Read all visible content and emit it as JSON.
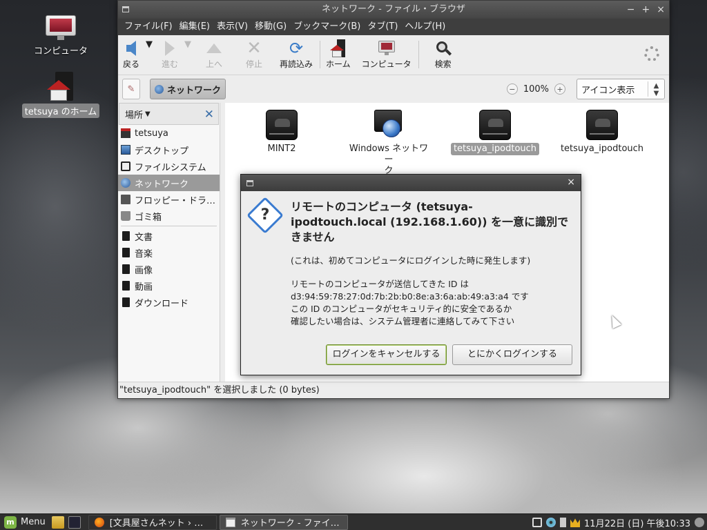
{
  "desktop": {
    "icons": [
      {
        "label": "コンピュータ"
      },
      {
        "label": "tetsuya のホーム"
      }
    ]
  },
  "window": {
    "title": "ネットワーク - ファイル・ブラウザ",
    "controls": {
      "minimize": "−",
      "maximize": "+",
      "close": "×"
    },
    "menu": [
      "ファイル(F)",
      "編集(E)",
      "表示(V)",
      "移動(G)",
      "ブックマーク(B)",
      "タブ(T)",
      "ヘルプ(H)"
    ],
    "toolbar": {
      "back": "戻る",
      "forward": "進む",
      "up": "上へ",
      "stop": "停止",
      "reload": "再読込み",
      "home": "ホーム",
      "computer": "コンピュータ",
      "search": "検索"
    },
    "location": {
      "path_button": "ネットワーク",
      "zoom_out": "−",
      "zoom": "100%",
      "zoom_in": "+",
      "view_mode": "アイコン表示"
    },
    "sidebar": {
      "header": "場所",
      "close": "✕",
      "places": [
        {
          "label": "tetsuya",
          "icon": "home-folder-icon"
        },
        {
          "label": "デスクトップ",
          "icon": "desktop-icon"
        },
        {
          "label": "ファイルシステム",
          "icon": "harddisk-icon"
        },
        {
          "label": "ネットワーク",
          "icon": "network-icon",
          "active": true
        },
        {
          "label": "フロッピー・ドラ…",
          "icon": "floppy-icon"
        },
        {
          "label": "ゴミ箱",
          "icon": "trash-icon"
        }
      ],
      "bookmarks": [
        {
          "label": "文書"
        },
        {
          "label": "音楽"
        },
        {
          "label": "画像"
        },
        {
          "label": "動画"
        },
        {
          "label": "ダウンロード"
        }
      ]
    },
    "files": [
      {
        "label": "MINT2",
        "icon": "network-drive-icon"
      },
      {
        "label_line1": "Windows ネットワー",
        "label_line2": "ク",
        "icon": "windows-network-icon"
      },
      {
        "label": "tetsuya_ipodtouch",
        "icon": "network-drive-icon",
        "selected": true
      },
      {
        "label": "tetsuya_ipodtouch",
        "icon": "network-drive-icon"
      }
    ],
    "status": "\"tetsuya_ipodtouch\" を選択しました (0 bytes)"
  },
  "dialog": {
    "close": "×",
    "heading_line1": "リモートのコンピュータ (tetsuya-",
    "heading_line2": "ipodtouch.local (192.168.1.60)) を一意に識別で",
    "heading_line3": "きません",
    "subtext": "(これは、初めてコンピュータにログインした時に発生します)",
    "body_line1": "リモートのコンピュータが送信してきた ID は",
    "body_line2": "d3:94:59:78:27:0d:7b:2b:b0:8e:a3:6a:ab:49:a3:a4 です",
    "body_line3": "この ID のコンピュータがセキュリティ的に安全であるか",
    "body_line4": "確認したい場合は、システム管理者に連絡してみて下さい",
    "cancel_button": "ログインをキャンセルする",
    "login_button": "とにかくログインする"
  },
  "panel": {
    "menu_label": "Menu",
    "tasks": [
      {
        "label": "[文具屋さんネット › …"
      },
      {
        "label": "ネットワーク - ファイ…"
      }
    ],
    "clock": "11月22日 (日) 午後10:33"
  }
}
